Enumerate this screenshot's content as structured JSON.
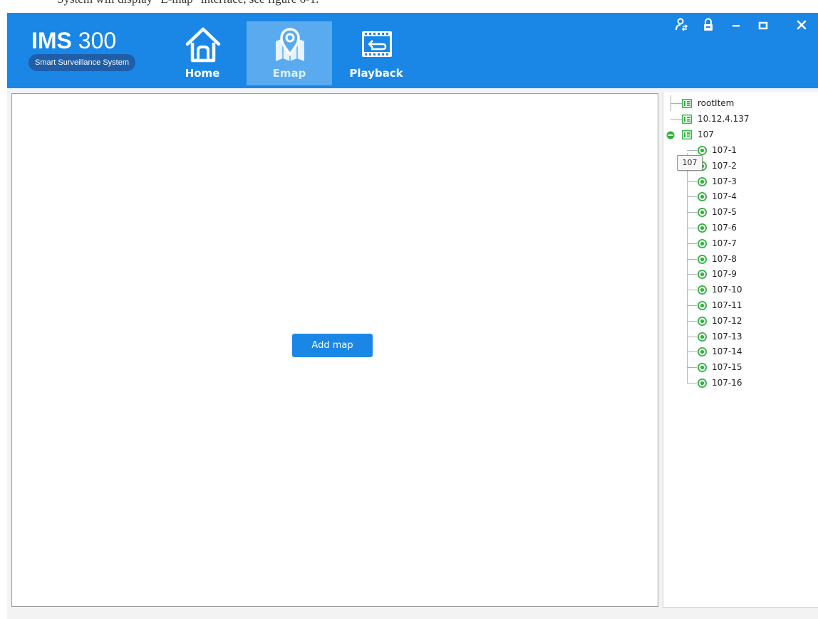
{
  "document_text": "System will display \"E-map\" interface, see figure 6-1.",
  "app": {
    "logo": {
      "brand": "IMS",
      "model": "300",
      "subtitle": "Smart Surveillance System"
    },
    "nav_tabs": [
      {
        "label": "Home",
        "icon": "home-icon",
        "active": false
      },
      {
        "label": "Emap",
        "icon": "map-pin-icon",
        "active": true
      },
      {
        "label": "Playback",
        "icon": "playback-icon",
        "active": false
      }
    ],
    "window_controls": [
      "user-switch-icon",
      "lock-icon",
      "minimize-icon",
      "maximize-icon",
      "close-icon"
    ],
    "colors": {
      "header_bg": "#1a87e6",
      "active_tab_bg": "#5aaaf0",
      "button_bg": "#1a87e6",
      "online_green": "#2fb33e"
    }
  },
  "map_panel": {
    "add_map_label": "Add map"
  },
  "device_tree": {
    "root": "rootItem",
    "device": "10.12.4.137",
    "group": "107",
    "channels": [
      "107-1",
      "107-2",
      "107-3",
      "107-4",
      "107-5",
      "107-6",
      "107-7",
      "107-8",
      "107-9",
      "107-10",
      "107-11",
      "107-12",
      "107-13",
      "107-14",
      "107-15",
      "107-16"
    ],
    "tooltip": "107"
  }
}
